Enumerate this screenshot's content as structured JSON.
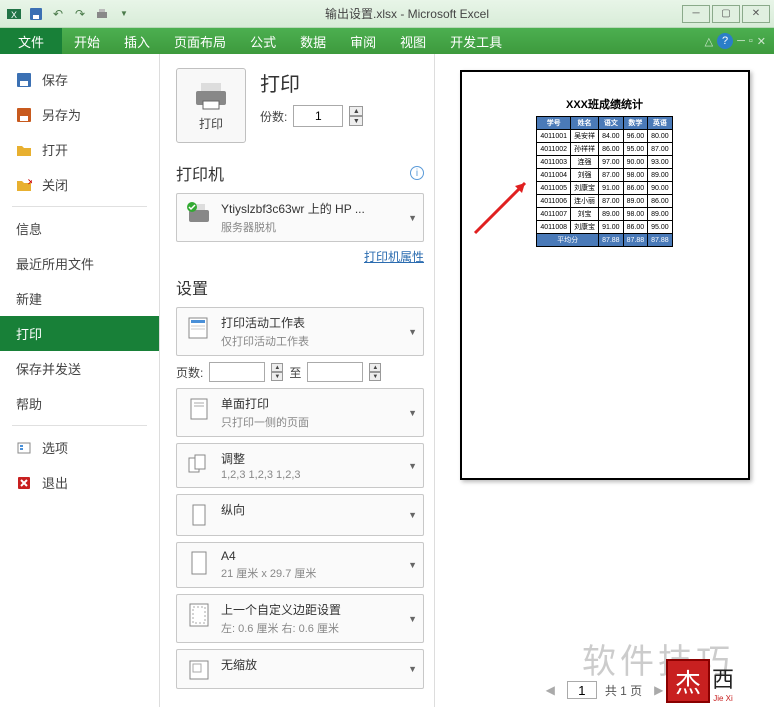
{
  "titlebar": {
    "title": "输出设置.xlsx - Microsoft Excel"
  },
  "ribbon": {
    "file": "文件",
    "tabs": [
      "开始",
      "插入",
      "页面布局",
      "公式",
      "数据",
      "审阅",
      "视图",
      "开发工具"
    ]
  },
  "backstage": {
    "save": "保存",
    "saveas": "另存为",
    "open": "打开",
    "close": "关闭",
    "info": "信息",
    "recent": "最近所用文件",
    "new": "新建",
    "print": "打印",
    "savesend": "保存并发送",
    "help": "帮助",
    "options": "选项",
    "exit": "退出"
  },
  "print": {
    "heading": "打印",
    "print_button_label": "打印",
    "copies_label": "份数:",
    "copies_value": "1",
    "printer_heading": "打印机",
    "printer_name": "Ytiyslzbf3c63wr 上的 HP ...",
    "printer_status": "服务器脱机",
    "printer_props": "打印机属性",
    "settings_heading": "设置",
    "active_sheets_title": "打印活动工作表",
    "active_sheets_sub": "仅打印活动工作表",
    "pages_label": "页数:",
    "pages_to": "至",
    "onesided_title": "单面打印",
    "onesided_sub": "只打印一侧的页面",
    "collate_title": "调整",
    "collate_sub": "1,2,3    1,2,3    1,2,3",
    "orientation": "纵向",
    "paper_title": "A4",
    "paper_sub": "21 厘米 x 29.7 厘米",
    "margins_title": "上一个自定义边距设置",
    "margins_sub": "左: 0.6 厘米   右: 0.6 厘米",
    "scaling": "无缩放"
  },
  "preview": {
    "page_input": "1",
    "page_total": "共 1 页",
    "doc_title": "XXX班成绩统计"
  },
  "chart_data": {
    "type": "table",
    "title": "XXX班成绩统计",
    "headers": [
      "学号",
      "姓名",
      "语文",
      "数学",
      "英语"
    ],
    "rows": [
      [
        "4011001",
        "吴安祥",
        "84.00",
        "96.00",
        "80.00"
      ],
      [
        "4011002",
        "孙祥祥",
        "86.00",
        "95.00",
        "87.00"
      ],
      [
        "4011003",
        "连强",
        "97.00",
        "90.00",
        "93.00"
      ],
      [
        "4011004",
        "刘强",
        "87.00",
        "98.00",
        "89.00"
      ],
      [
        "4011005",
        "刘康宝",
        "91.00",
        "86.00",
        "90.00"
      ],
      [
        "4011006",
        "连小丽",
        "87.00",
        "89.00",
        "86.00"
      ],
      [
        "4011007",
        "刘宝",
        "89.00",
        "98.00",
        "89.00"
      ],
      [
        "4011008",
        "刘康宝",
        "91.00",
        "86.00",
        "95.00"
      ]
    ],
    "avg_label": "平均分",
    "avg_values": [
      "87.88",
      "87.88",
      "87.88"
    ]
  },
  "watermark": {
    "text": "软件技巧",
    "stamp_big": "杰",
    "stamp_small": "西",
    "stamp_sub": "Jie Xi"
  }
}
